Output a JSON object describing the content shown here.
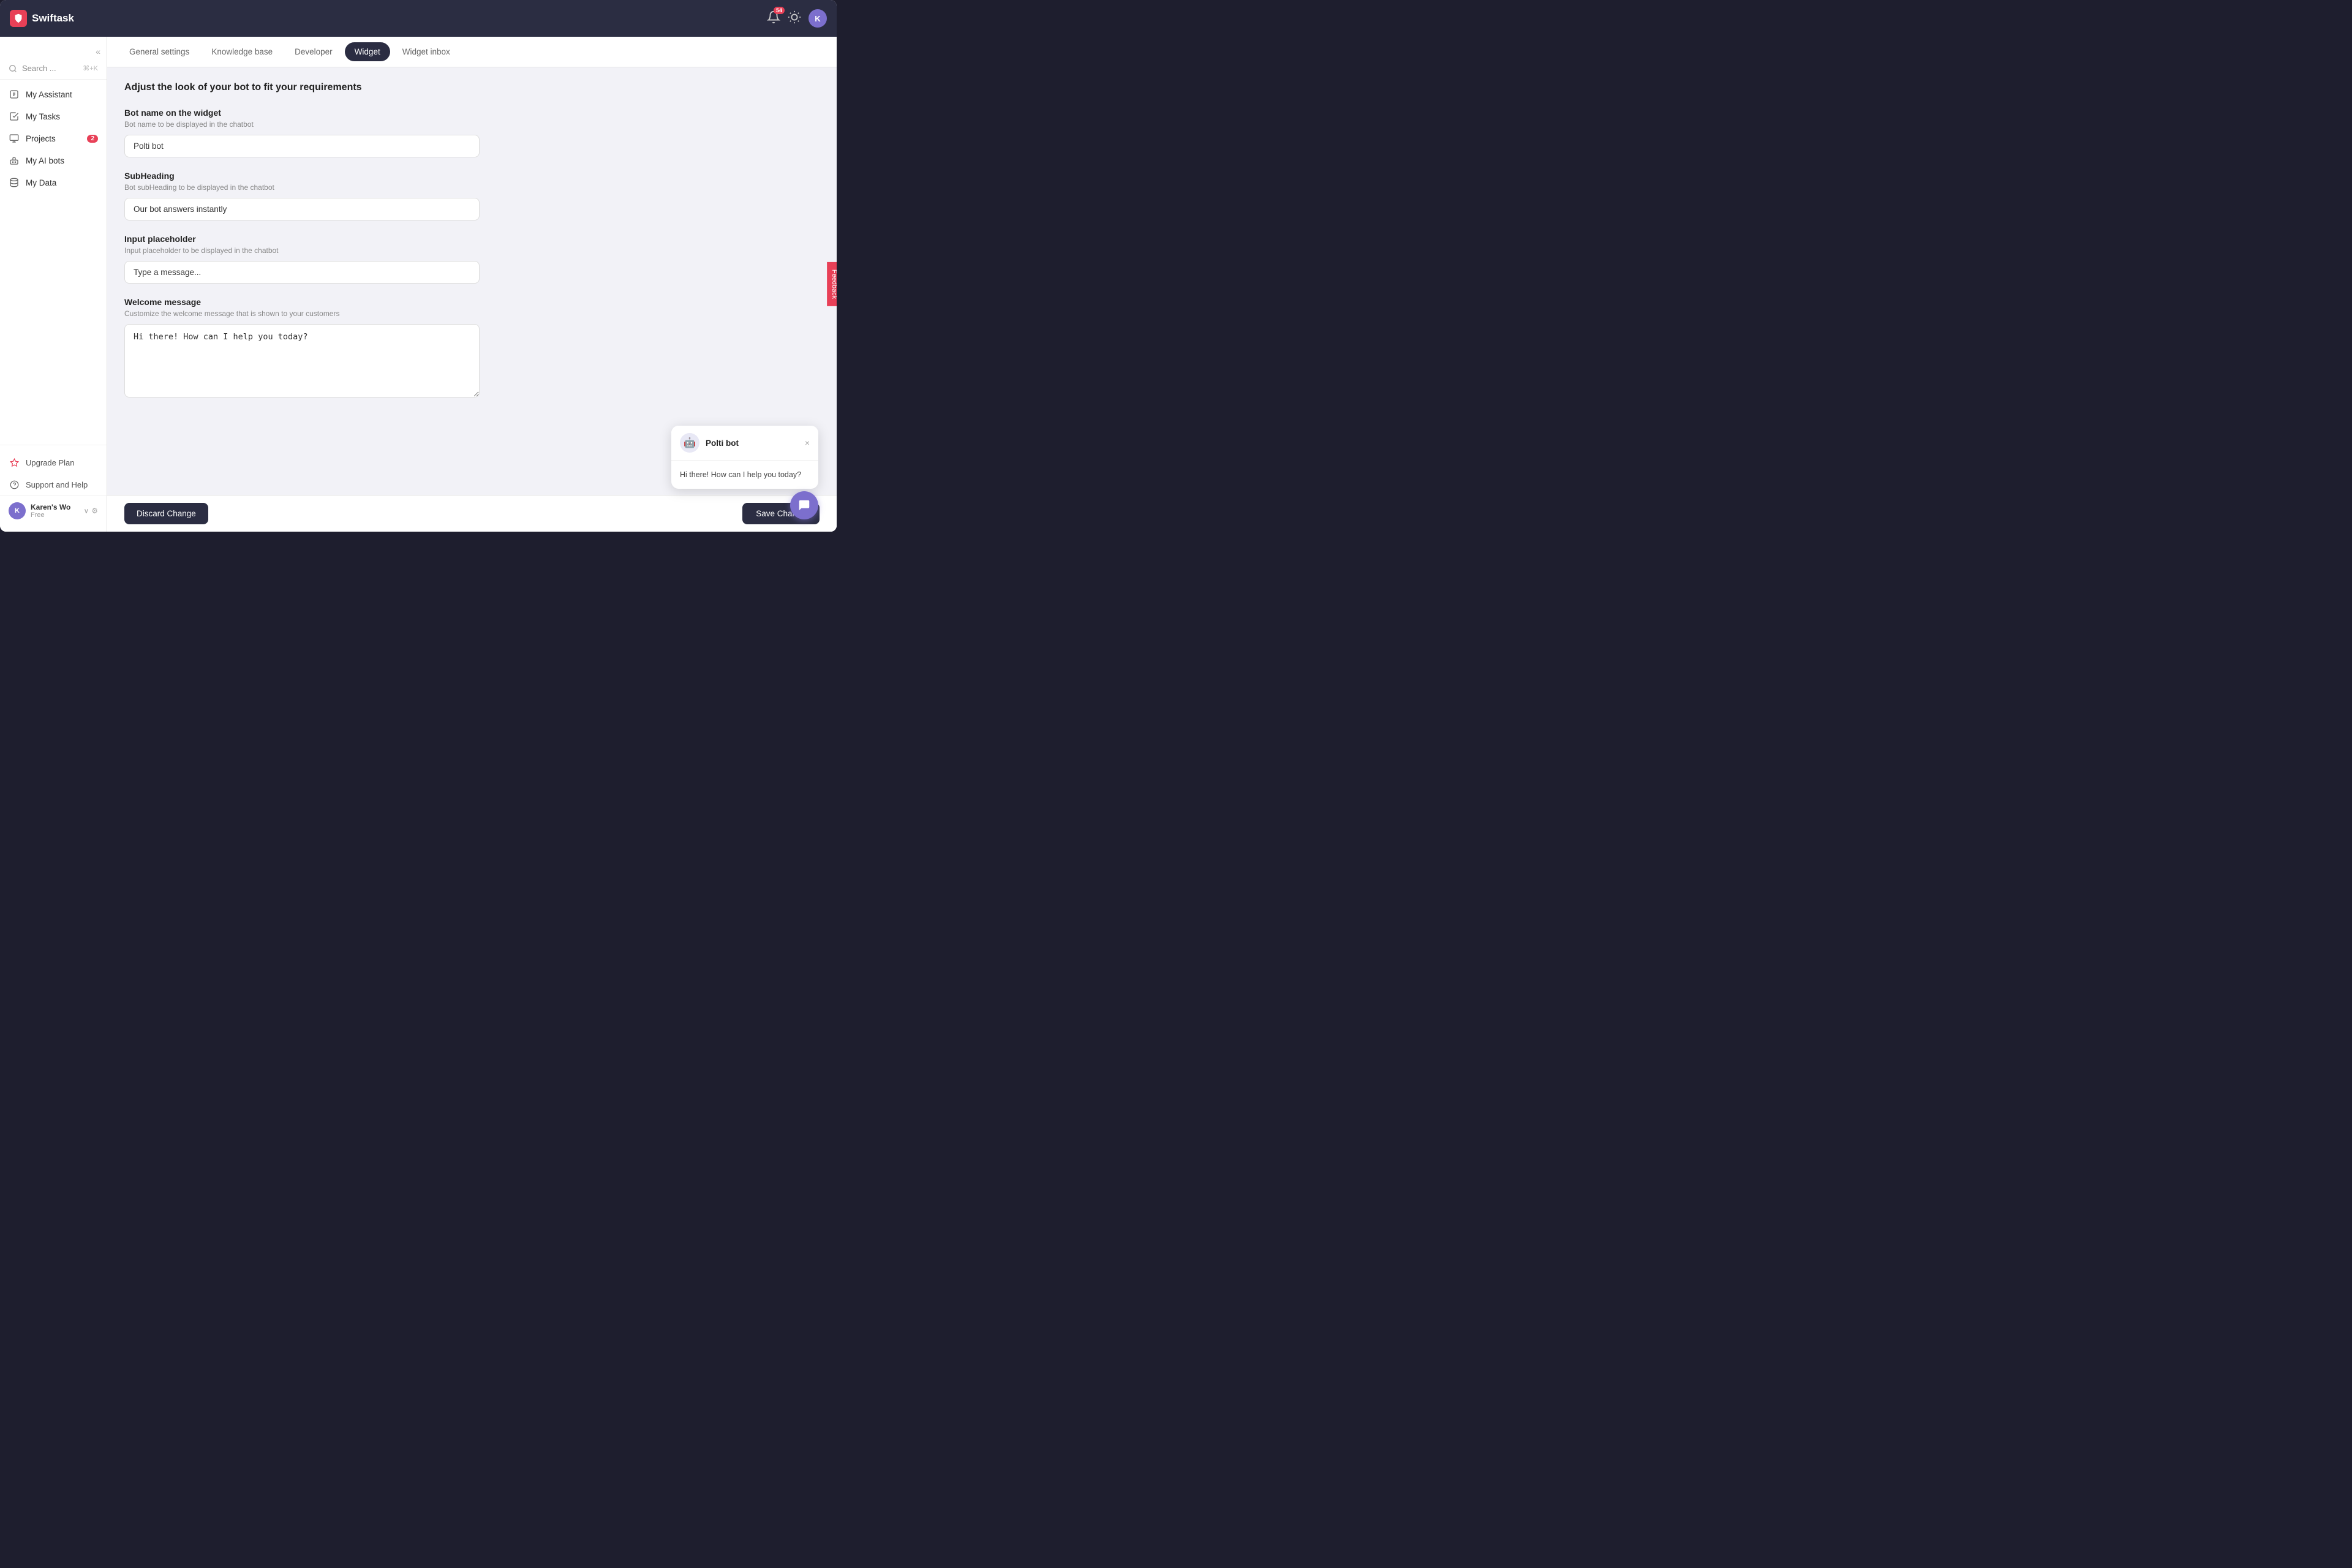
{
  "app": {
    "title": "Swiftask",
    "notifications_count": "54"
  },
  "sidebar": {
    "collapse_label": "«",
    "search_placeholder": "Search ...",
    "search_shortcut": "⌘+K",
    "nav_items": [
      {
        "id": "my-assistant",
        "label": "My Assistant",
        "icon": "assistant"
      },
      {
        "id": "my-tasks",
        "label": "My Tasks",
        "icon": "tasks"
      },
      {
        "id": "projects",
        "label": "Projects",
        "icon": "projects",
        "badge": "2"
      },
      {
        "id": "my-ai-bots",
        "label": "My AI bots",
        "icon": "bots"
      },
      {
        "id": "my-data",
        "label": "My Data",
        "icon": "data"
      }
    ],
    "bottom_items": [
      {
        "id": "upgrade-plan",
        "label": "Upgrade Plan",
        "icon": "upgrade"
      },
      {
        "id": "support-and-help",
        "label": "Support and Help",
        "icon": "support"
      }
    ],
    "user": {
      "name": "Karen's Wo",
      "plan": "Free"
    }
  },
  "tabs": [
    {
      "id": "general-settings",
      "label": "General settings",
      "active": false
    },
    {
      "id": "knowledge-base",
      "label": "Knowledge base",
      "active": false
    },
    {
      "id": "developer",
      "label": "Developer",
      "active": false
    },
    {
      "id": "widget",
      "label": "Widget",
      "active": true
    },
    {
      "id": "widget-inbox",
      "label": "Widget inbox",
      "active": false
    }
  ],
  "form": {
    "title": "Adjust the look of your bot to fit your requirements",
    "bot_name": {
      "label": "Bot name on the widget",
      "sublabel": "Bot name to be displayed in the chatbot",
      "value": "Polti bot"
    },
    "subheading": {
      "label": "SubHeading",
      "sublabel": "Bot subHeading to be displayed in the chatbot",
      "value": "Our bot answers instantly"
    },
    "input_placeholder": {
      "label": "Input placeholder",
      "sublabel": "Input placeholder to be displayed in the chatbot",
      "value": "Type a message..."
    },
    "welcome_message": {
      "label": "Welcome message",
      "sublabel": "Customize the welcome message that is shown to your customers",
      "value": "Hi there! How can I help you today?"
    }
  },
  "buttons": {
    "discard": "Discard Change",
    "save": "Save Change"
  },
  "chat_widget": {
    "bot_name": "Polti bot",
    "message": "Hi there! How can I help you today?",
    "close_label": "×"
  },
  "feedback_tab": "Feedback"
}
